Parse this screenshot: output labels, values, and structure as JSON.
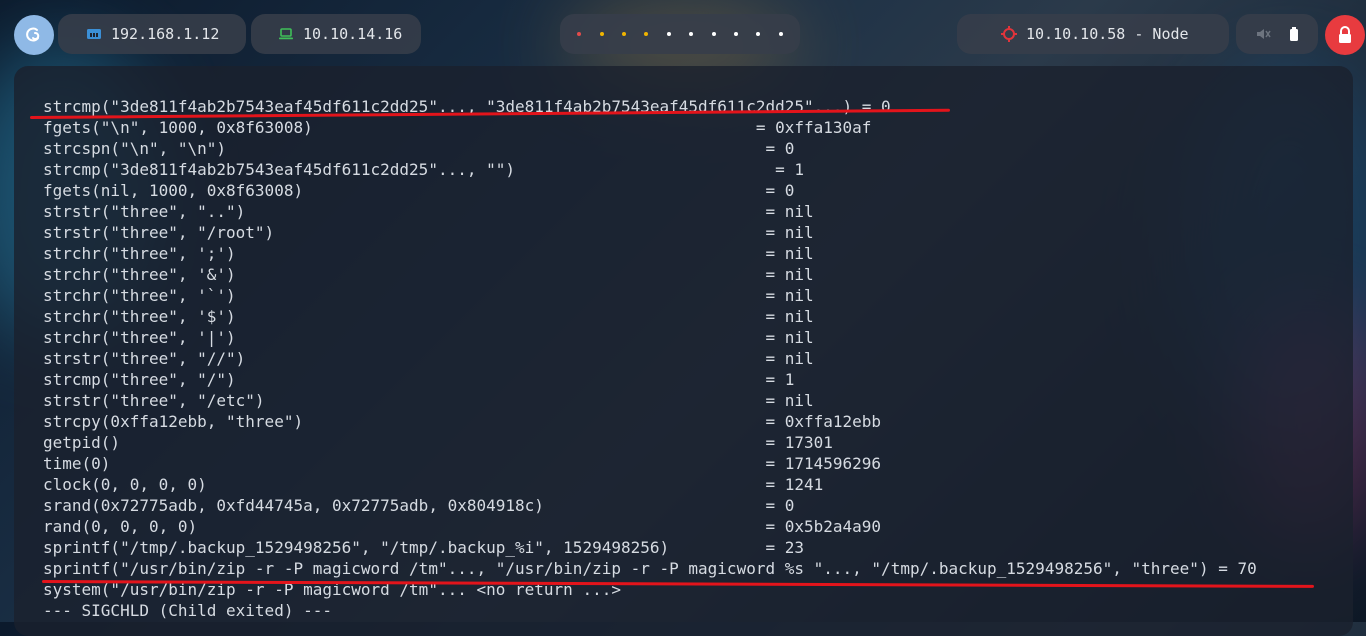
{
  "topbar": {
    "host_ip": "192.168.1.12",
    "vpn_ip": "10.10.14.16",
    "workspace_dots": [
      "#e24b4b",
      "#f0b400",
      "#f0b400",
      "#f0b400",
      "#ffffff",
      "#ffffff",
      "#ffffff",
      "#ffffff",
      "#ffffff",
      "#ffffff"
    ],
    "target_label": "10.10.10.58 - Node",
    "icons": {
      "launcher": "debian-swirl-icon",
      "host": "network-icon",
      "vpn": "laptop-icon",
      "target": "crosshair-icon",
      "mute": "speaker-muted-icon",
      "battery": "battery-icon",
      "lock": "lock-icon"
    },
    "colors": {
      "host_icon": "#3b8fd6",
      "vpn_icon": "#3fbf59",
      "target_icon": "#e2343b",
      "lock_button": "#e83b3f"
    }
  },
  "terminal": {
    "lines": [
      "strcmp(\"3de811f4ab2b7543eaf45df611c2dd25\"..., \"3de811f4ab2b7543eaf45df611c2dd25\"...) = 0",
      "fgets(\"\\n\", 1000, 0x8f63008)                                              = 0xffa130af",
      "strcspn(\"\\n\", \"\\n\")                                                        = 0",
      "strcmp(\"3de811f4ab2b7543eaf45df611c2dd25\"..., \"\")                           = 1",
      "fgets(nil, 1000, 0x8f63008)                                                = 0",
      "strstr(\"three\", \"..\")                                                      = nil",
      "strstr(\"three\", \"/root\")                                                   = nil",
      "strchr(\"three\", ';')                                                       = nil",
      "strchr(\"three\", '&')                                                       = nil",
      "strchr(\"three\", '`')                                                       = nil",
      "strchr(\"three\", '$')                                                       = nil",
      "strchr(\"three\", '|')                                                       = nil",
      "strstr(\"three\", \"//\")                                                      = nil",
      "strcmp(\"three\", \"/\")                                                       = 1",
      "strstr(\"three\", \"/etc\")                                                    = nil",
      "strcpy(0xffa12ebb, \"three\")                                                = 0xffa12ebb",
      "getpid()                                                                   = 17301",
      "time(0)                                                                    = 1714596296",
      "clock(0, 0, 0, 0)                                                          = 1241",
      "srand(0x72775adb, 0xfd44745a, 0x72775adb, 0x804918c)                       = 0",
      "rand(0, 0, 0, 0)                                                           = 0x5b2a4a90",
      "sprintf(\"/tmp/.backup_1529498256\", \"/tmp/.backup_%i\", 1529498256)          = 23",
      "sprintf(\"/usr/bin/zip -r -P magicword /tm\"..., \"/usr/bin/zip -r -P magicword %s \"..., \"/tmp/.backup_1529498256\", \"three\") = 70",
      "system(\"/usr/bin/zip -r -P magicword /tm\"... <no return ...>",
      "--- SIGCHLD (Child exited) ---"
    ]
  }
}
